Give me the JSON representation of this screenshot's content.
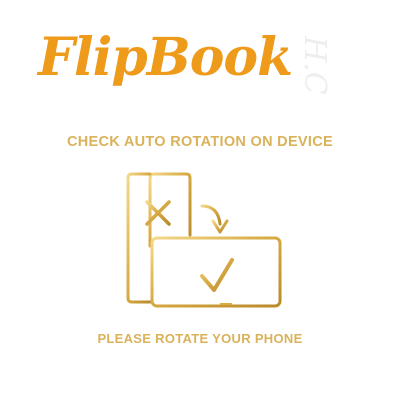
{
  "brand": {
    "logo_text": "FlipBook",
    "watermark_text": "H.C",
    "accent_color": "#ee9a1a",
    "gold_color": "#d9b25a"
  },
  "messages": {
    "top": "CHECK AUTO ROTATION ON DEVICE",
    "bottom": "PLEASE ROTATE YOUR PHONE"
  },
  "icons": {
    "portrait": "portrait-phone-icon",
    "cross": "x-mark-icon",
    "arrow": "rotate-arrow-icon",
    "landscape": "landscape-phone-icon",
    "check": "checkmark-icon"
  }
}
